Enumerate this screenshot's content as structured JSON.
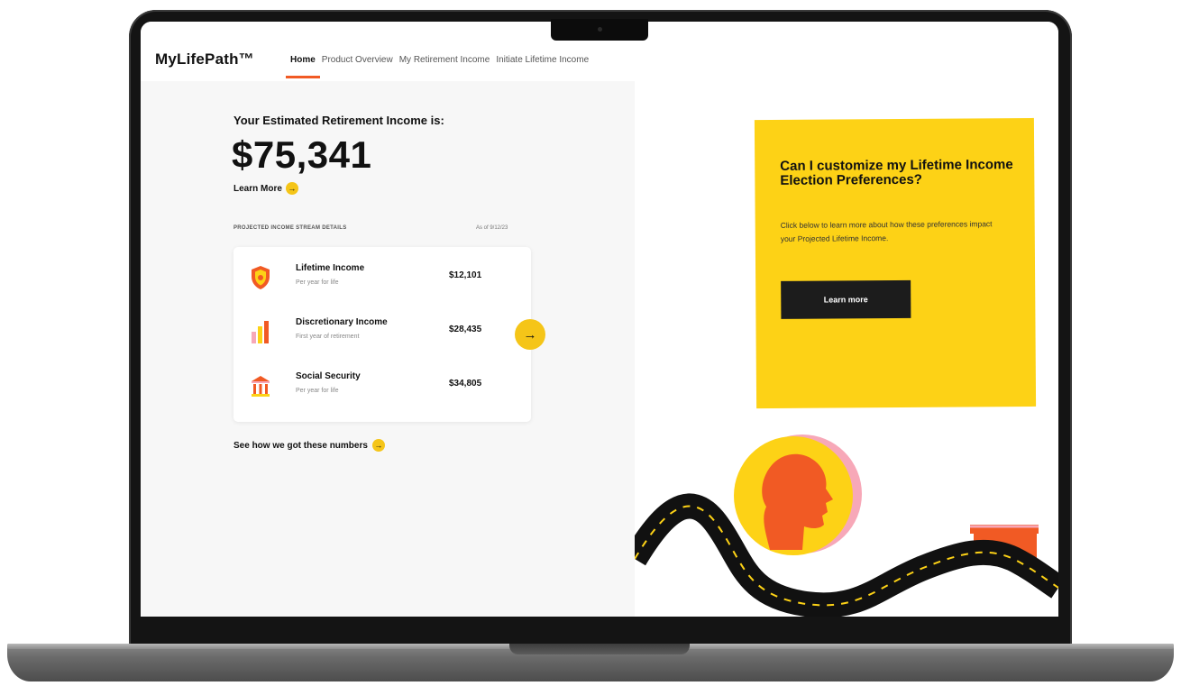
{
  "app": {
    "logo": "MyLifePath™"
  },
  "nav": [
    {
      "label": "Home",
      "active": true
    },
    {
      "label": "Product Overview",
      "active": false
    },
    {
      "label": "My Retirement Income",
      "active": false
    },
    {
      "label": "Initiate Lifetime Income",
      "active": false
    }
  ],
  "summary": {
    "label": "Your Estimated Retirement Income is:",
    "value": "$75,341",
    "learn_more": "Learn More"
  },
  "projected": {
    "label": "PROJECTED INCOME STREAM DETAILS",
    "as_of": "As of 9/12/23",
    "rows": [
      {
        "title": "Lifetime Income",
        "subtitle": "Per year for life",
        "amount": "$12,101",
        "icon": "shield-icon"
      },
      {
        "title": "Discretionary Income",
        "subtitle": "First year of retirement",
        "amount": "$28,435",
        "icon": "bar-chart-icon"
      },
      {
        "title": "Social Security",
        "subtitle": "Per year for life",
        "amount": "$34,805",
        "icon": "bank-icon"
      }
    ],
    "see_how": "See how we got these numbers"
  },
  "callout": {
    "title": "Can I customize my Lifetime Income Election Preferences?",
    "body": "Click below to learn more about how these preferences impact your Projected Lifetime Income.",
    "button": "Learn more"
  },
  "colors": {
    "accent_yellow": "#fdd216",
    "accent_orange": "#f15a24",
    "dark": "#1c1c1c"
  }
}
